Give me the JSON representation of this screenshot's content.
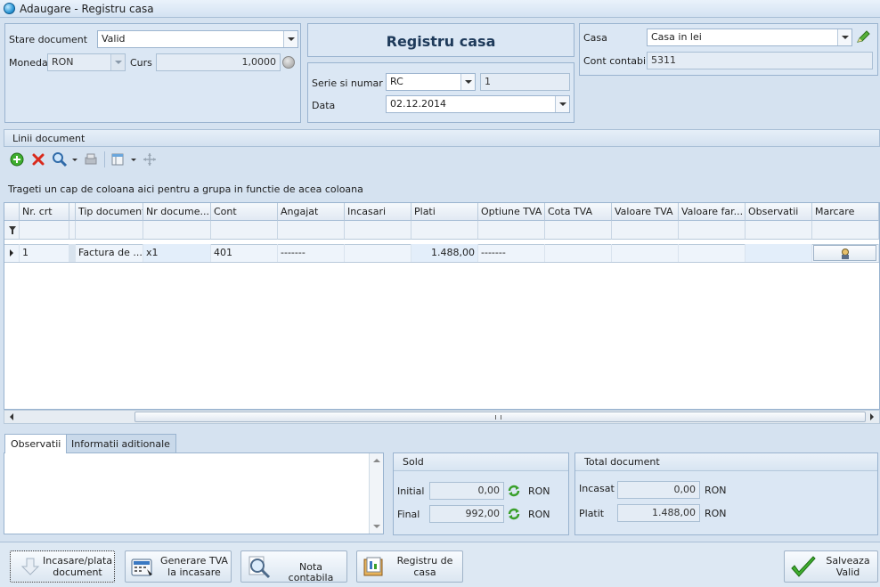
{
  "window": {
    "title": "Adaugare - Registru casa"
  },
  "doc_panel": {
    "stare_label": "Stare document",
    "stare_value": "Valid",
    "moneda_label": "Moneda",
    "moneda_value": "RON",
    "curs_label": "Curs",
    "curs_value": "1,0000"
  },
  "header_panel": {
    "title": "Registru casa",
    "serie_label": "Serie si numar",
    "serie_value": "RC",
    "numar_value": "1",
    "data_label": "Data",
    "data_value": "02.12.2014"
  },
  "casa_panel": {
    "casa_label": "Casa",
    "casa_value": "Casa in lei",
    "cont_label": "Cont contabil",
    "cont_value": "5311"
  },
  "lines": {
    "section_title": "Linii document",
    "group_hint": "Trageti un cap de coloana aici pentru a grupa in functie de acea coloana",
    "columns": [
      "Nr. crt",
      "Tip document",
      "Nr docume...",
      "Cont",
      "Angajat",
      "Incasari",
      "Plati",
      "Optiune TVA",
      "Cota TVA",
      "Valoare TVA",
      "Valoare far...",
      "Observatii",
      "Marcare"
    ],
    "rows": [
      {
        "nr": "1",
        "tip": "Factura de ...",
        "nrdoc": "x1",
        "cont": "401",
        "angajat": "-------",
        "incasari": "",
        "plati": "1.488,00",
        "optiune": "-------",
        "cota": "",
        "valtva": "",
        "valfara": "",
        "obs": ""
      }
    ]
  },
  "tabs": [
    "Observatii",
    "Informatii aditionale"
  ],
  "sold": {
    "title": "Sold",
    "initial_label": "Initial",
    "initial_value": "0,00",
    "final_label": "Final",
    "final_value": "992,00",
    "currency": "RON"
  },
  "total": {
    "title": "Total document",
    "incasat_label": "Incasat",
    "incasat_value": "0,00",
    "platit_label": "Platit",
    "platit_value": "1.488,00",
    "currency": "RON"
  },
  "buttons": {
    "incasare_l1": "Incasare/plata",
    "incasare_l2": "document",
    "tva_l1": "Generare TVA",
    "tva_l2": "la incasare",
    "nota": "Nota contabila",
    "registru_l1": "Registru de",
    "registru_l2": "casa",
    "salveaza_l1": "Salveaza",
    "salveaza_l2": "Valid"
  },
  "icons": [
    "app-icon",
    "dropdown-icon",
    "edit-pencil-icon",
    "info-circle-icon",
    "add-icon",
    "delete-icon",
    "search-icon",
    "print-icon",
    "columns-icon",
    "move-icon",
    "filter-icon",
    "row-indicator-icon",
    "mark-icon",
    "refresh-icon",
    "arrow-down-icon",
    "calculator-icon",
    "magnifier-icon",
    "book-icon",
    "checkmark-icon"
  ],
  "colors": {
    "accent": "#2f9ad8",
    "panel": "#dbe7f4",
    "border": "#99b3cf"
  }
}
